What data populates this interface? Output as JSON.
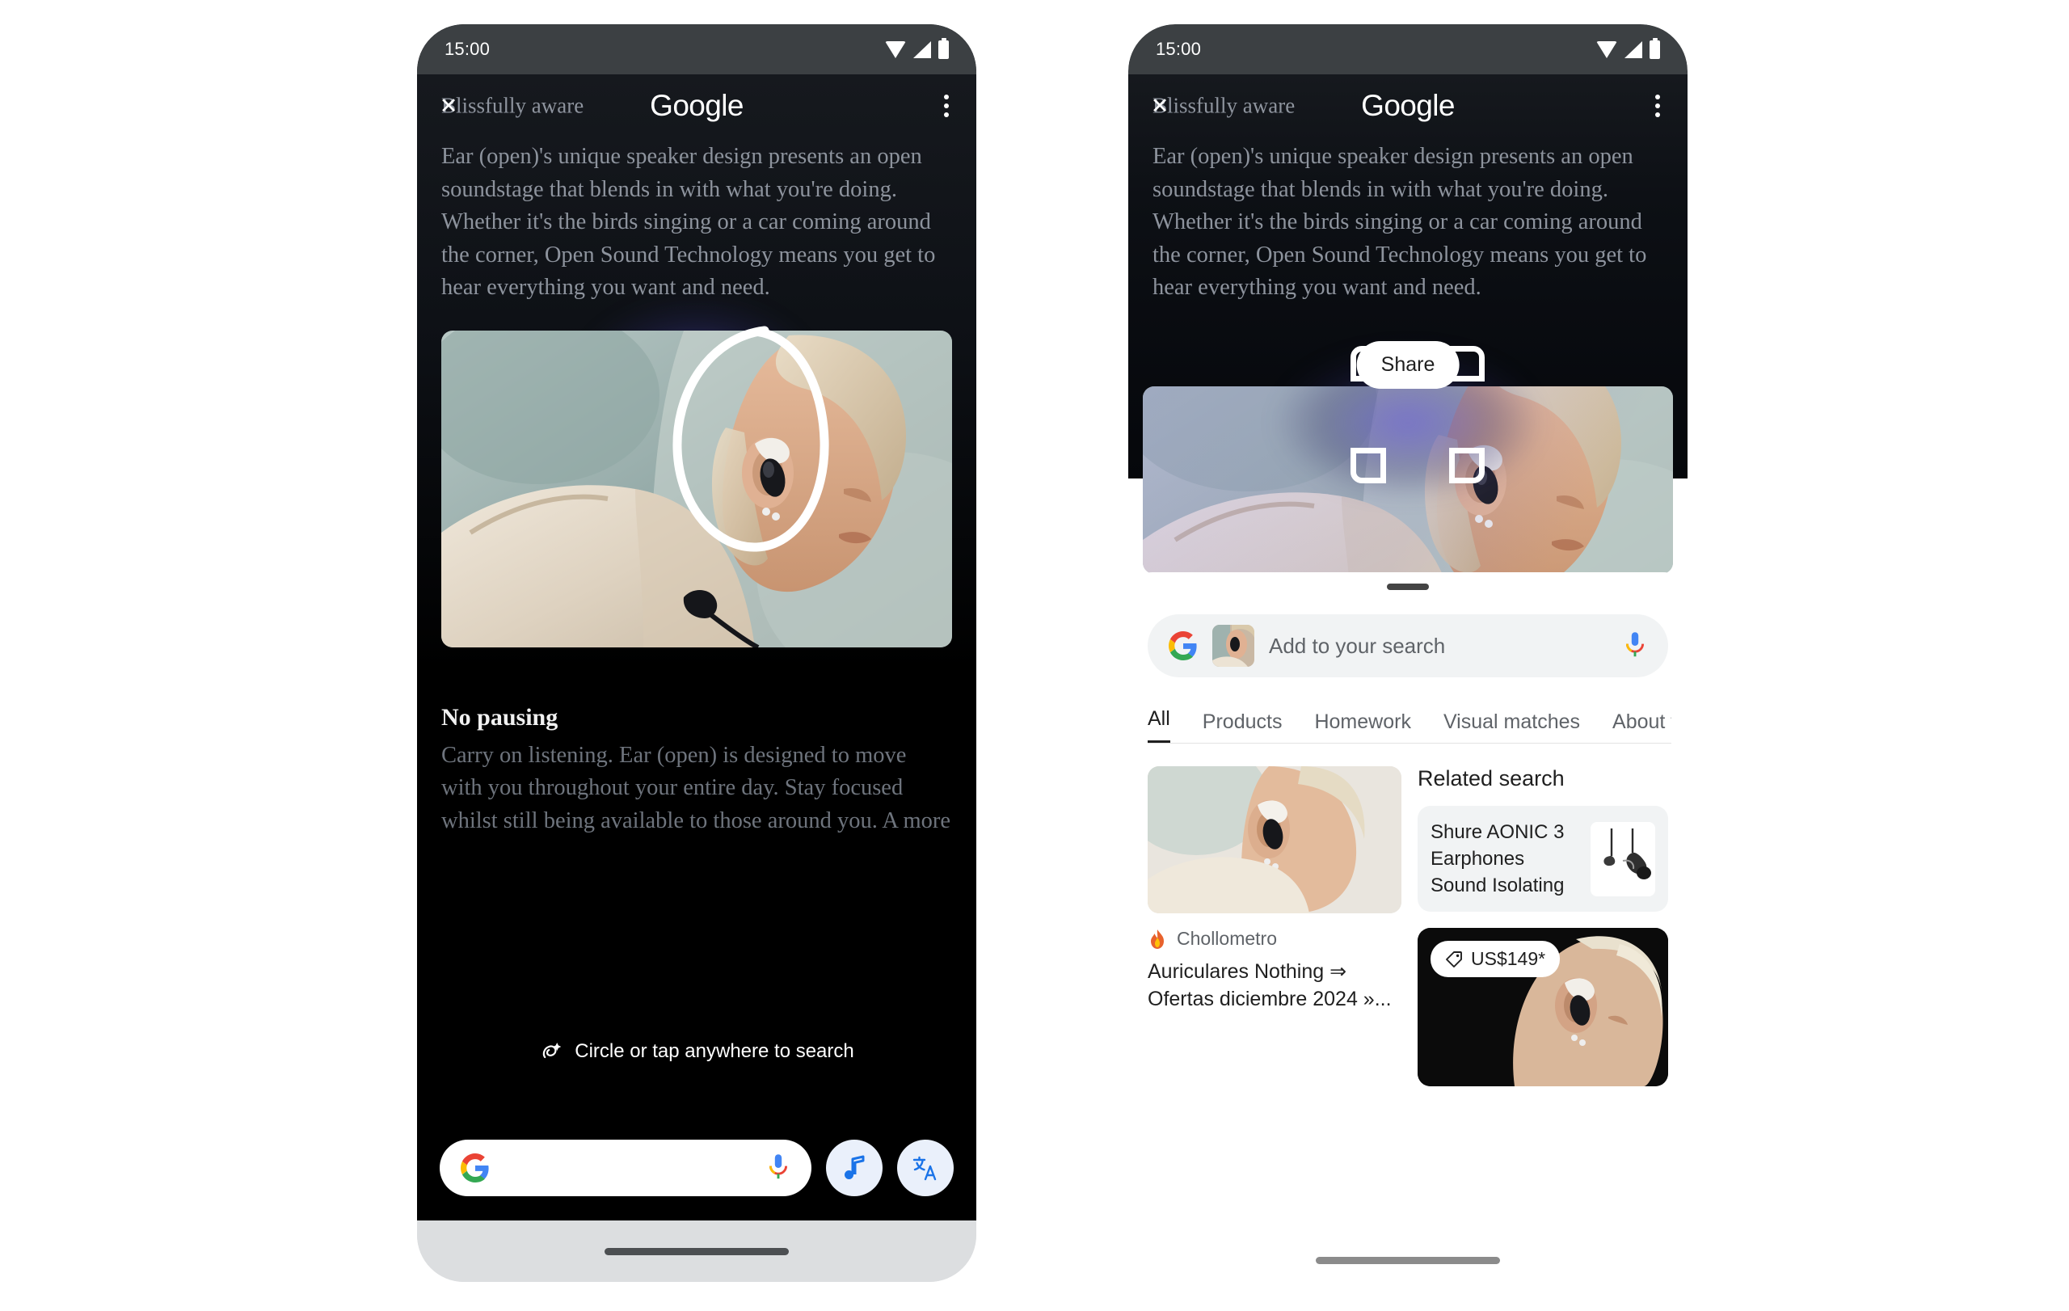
{
  "status_bar": {
    "time": "15:00",
    "icons": [
      "wifi-icon",
      "signal-icon",
      "battery-icon"
    ]
  },
  "app_bar": {
    "close_label": "✕",
    "page_title_behind": "Blissfully aware",
    "brand": "Google",
    "overflow_icon": "kebab-menu-icon"
  },
  "article": {
    "paragraph_1": "Ear (open)'s unique speaker design presents an open soundstage that blends in with what you're doing. Whether it's the birds singing or a car coming around the corner, Open Sound Technology means you get to hear everything you want and need.",
    "section_heading": "No pausing",
    "paragraph_2": "Carry on listening. Ear (open) is designed to move with you throughout your entire day. Stay focused whilst still being available to those around you. A more"
  },
  "left_phone": {
    "hint": {
      "icon": "circle-to-search-icon",
      "text": "Circle or tap anywhere to search"
    },
    "bottom_bar": {
      "search_placeholder": "",
      "google_icon": "google-g-icon",
      "mic_icon": "microphone-icon",
      "music_button_icon": "music-note-icon",
      "translate_button_icon": "translate-icon"
    },
    "home_indicator": "home-indicator"
  },
  "right_phone": {
    "share_chip": "Share",
    "selection_frame": "crop-selection-frame",
    "sheet_handle": "bottom-sheet-handle",
    "search": {
      "google_icon": "google-g-icon",
      "thumbnail": "selected-image-thumbnail",
      "placeholder": "Add to your search",
      "mic_icon": "microphone-icon"
    },
    "tabs": [
      {
        "label": "All",
        "active": true
      },
      {
        "label": "Products",
        "active": false
      },
      {
        "label": "Homework",
        "active": false
      },
      {
        "label": "Visual matches",
        "active": false
      },
      {
        "label": "About t",
        "active": false
      }
    ],
    "results": {
      "left_card": {
        "source_icon": "flame-icon",
        "source": "Chollometro",
        "title": "Auriculares Nothing ⇒ Ofertas diciembre 2024 »..."
      },
      "related": {
        "heading": "Related search",
        "card_title": "Shure AONIC 3 Earphones Sound Isolating",
        "card_thumb": "earphones-thumbnail"
      },
      "product_card": {
        "price_icon": "price-tag-icon",
        "price": "US$149*"
      }
    },
    "home_indicator": "home-indicator"
  },
  "colors": {
    "google_blue": "#4285F4",
    "google_red": "#EA4335",
    "google_yellow": "#FBBC05",
    "google_green": "#34A853",
    "status_bar_bg": "#3C4043",
    "sheet_bg": "#FFFFFF",
    "chip_bg": "#F1F3F4"
  }
}
